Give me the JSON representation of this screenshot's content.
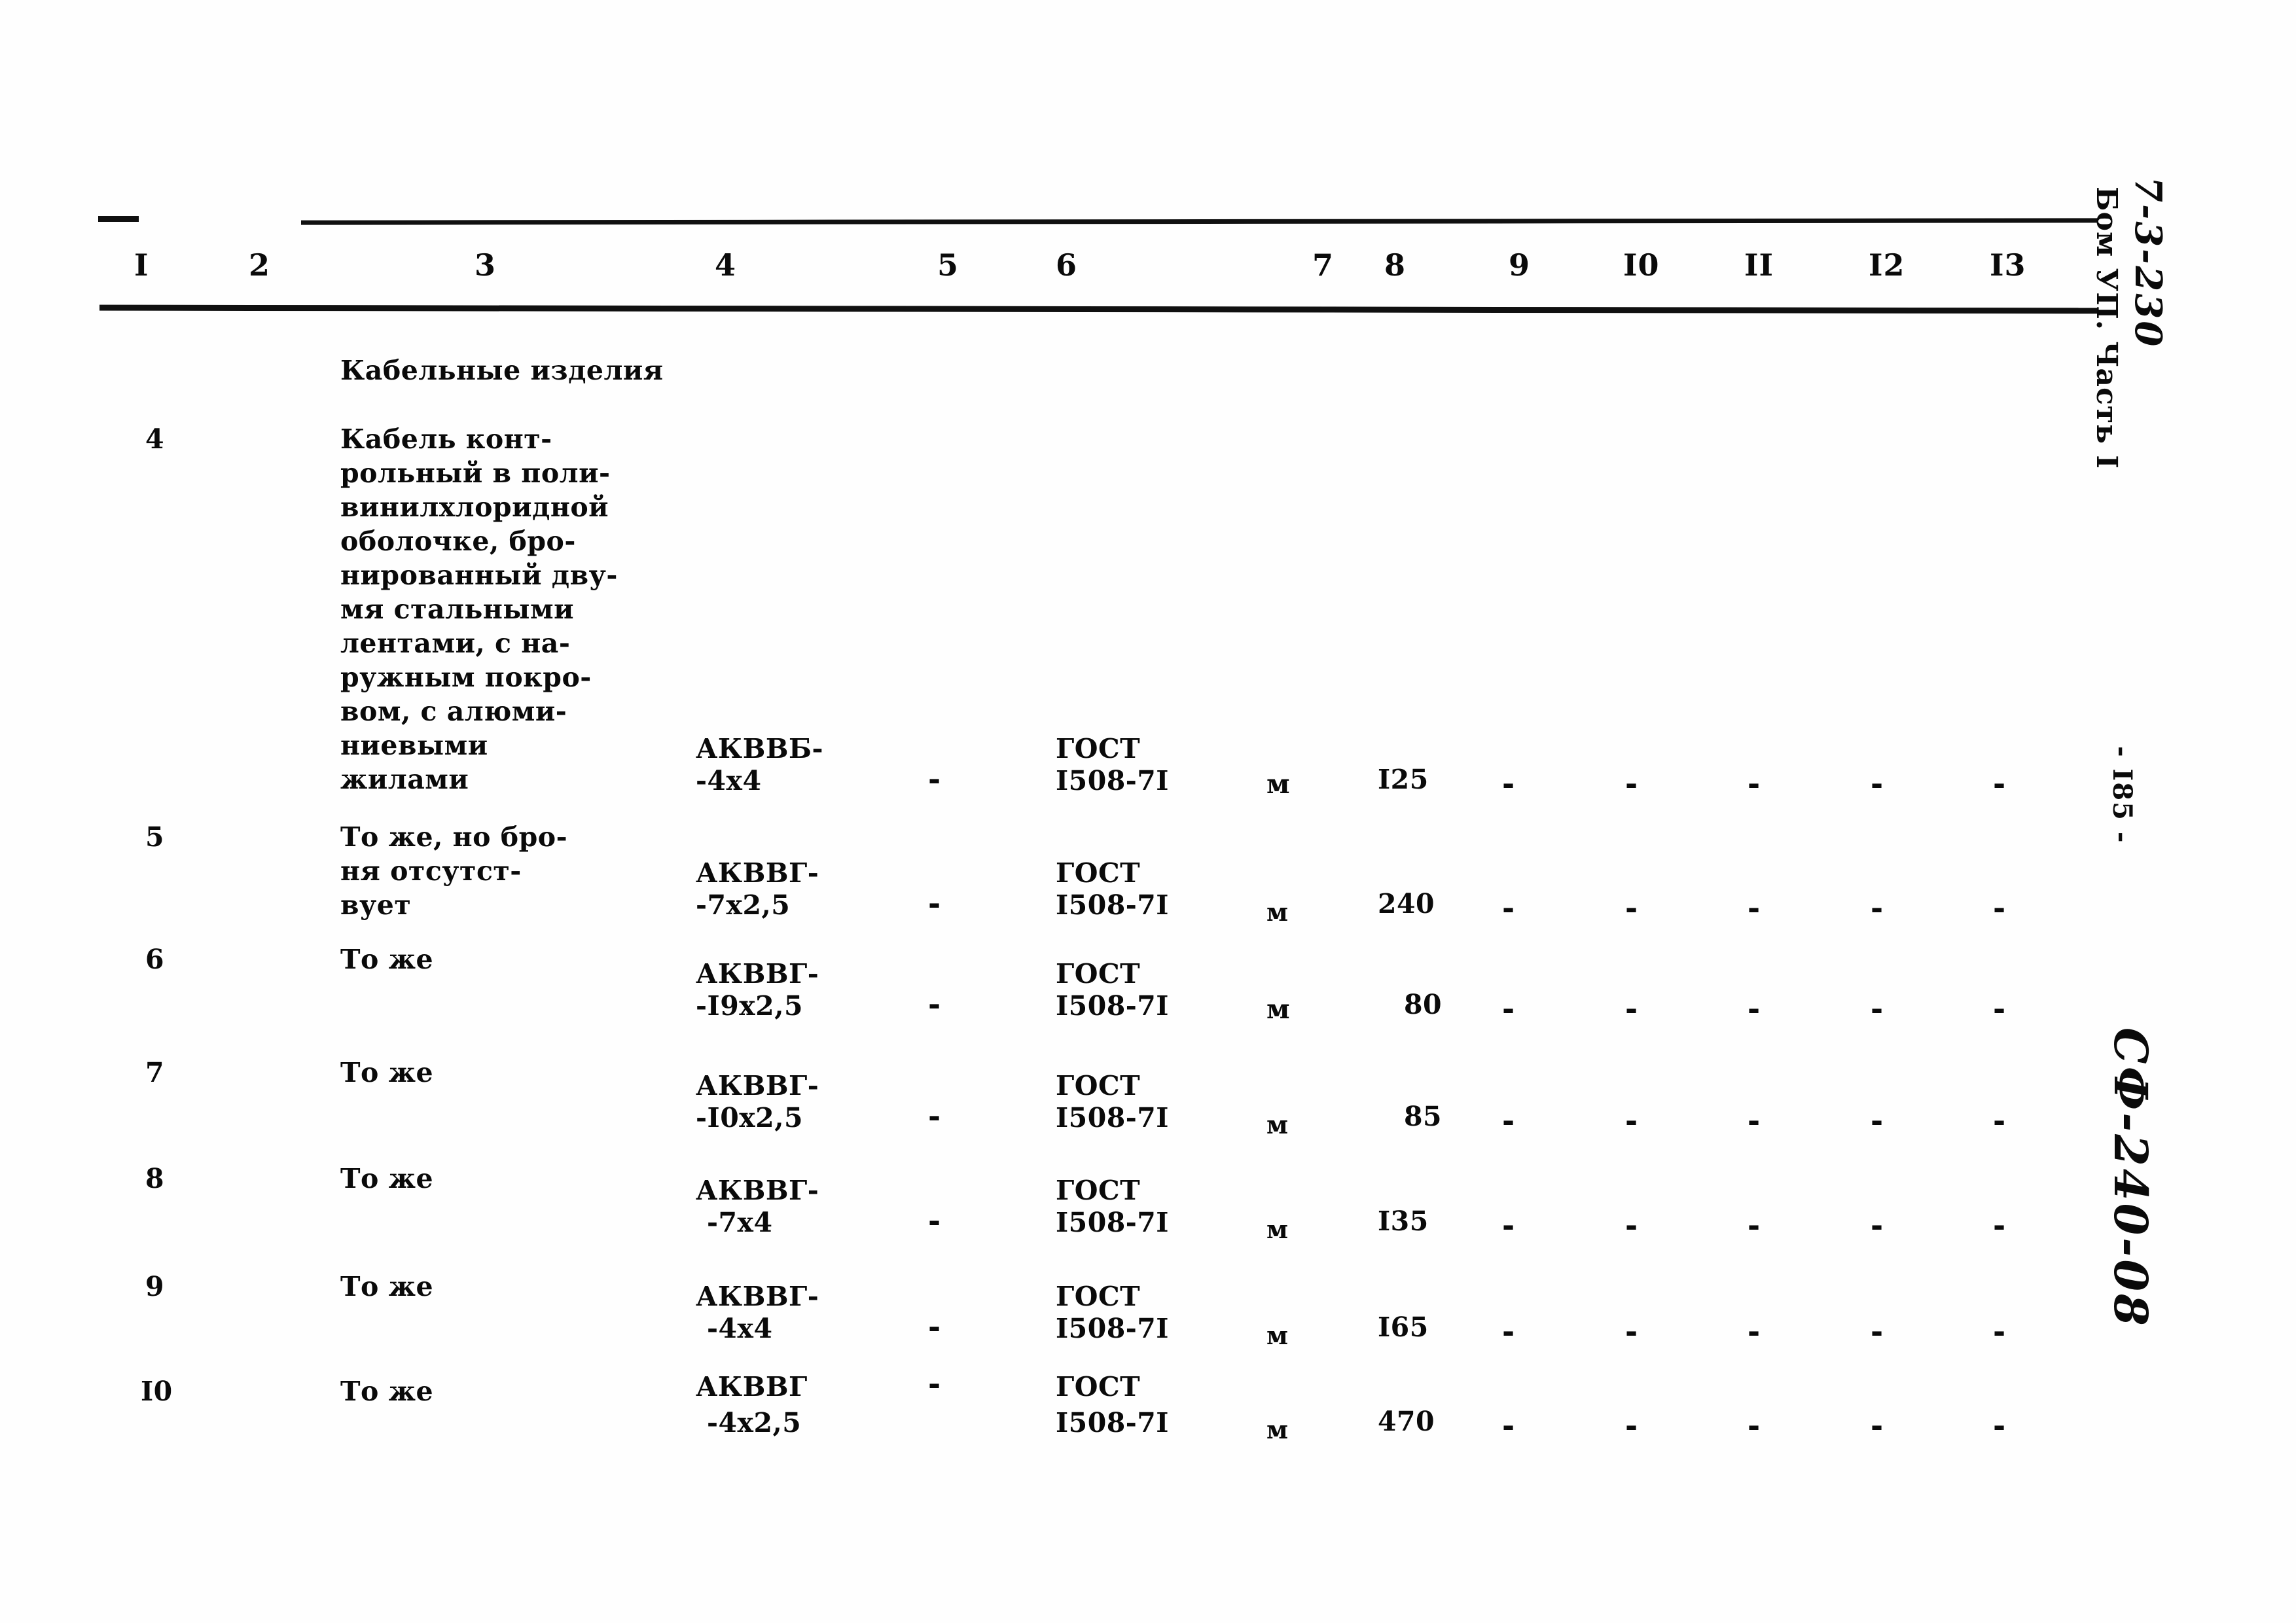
{
  "document": {
    "page_marker": "- I85 -",
    "margin_handwritten_top": "7-3-230",
    "margin_volume_line": "Бом УП. Часть I",
    "margin_handwritten_code": "СФ-240-08"
  },
  "table": {
    "column_headers": [
      "I",
      "2",
      "3",
      "4",
      "5",
      "6",
      "7",
      "8",
      "9",
      "I0",
      "II",
      "I2",
      "I3"
    ],
    "section_title": "Кабельные изделия",
    "rows": [
      {
        "num": "4",
        "name_lines": [
          "Кабель конт-",
          "рольный в поли-",
          "винилхлоридной",
          "оболочке, бро-",
          "нированный дву-",
          "мя стальными",
          "лентами, с на-",
          "ружным покро-",
          "вом, с алюми-",
          "ниевыми",
          "жилами"
        ],
        "type_line1": "АКВВБ-",
        "type_line2": "-4х4",
        "col5": "-",
        "gost_line1": "ГОСТ",
        "gost_line2": "I508-7I",
        "unit": "м",
        "qty": "I25",
        "tail": [
          "-",
          "-",
          "-",
          "-",
          "-"
        ]
      },
      {
        "num": "5",
        "name_lines": [
          "То же, но бро-",
          "ня отсутст-",
          "вует"
        ],
        "type_line1": "АКВВГ-",
        "type_line2": "-7х2,5",
        "col5": "-",
        "gost_line1": "ГОСТ",
        "gost_line2": "I508-7I",
        "unit": "м",
        "qty": "240",
        "tail": [
          "-",
          "-",
          "-",
          "-",
          "-"
        ]
      },
      {
        "num": "6",
        "name_lines": [
          "То же"
        ],
        "type_line1": "АКВВГ-",
        "type_line2": "-I9х2,5",
        "col5": "-",
        "gost_line1": "ГОСТ",
        "gost_line2": "I508-7I",
        "unit": "м",
        "qty": "80",
        "tail": [
          "-",
          "-",
          "-",
          "-",
          "-"
        ]
      },
      {
        "num": "7",
        "name_lines": [
          "То же"
        ],
        "type_line1": "АКВВГ-",
        "type_line2": "-I0х2,5",
        "col5": "-",
        "gost_line1": "ГОСТ",
        "gost_line2": "I508-7I",
        "unit": "м",
        "qty": "85",
        "tail": [
          "-",
          "-",
          "-",
          "-",
          "-"
        ]
      },
      {
        "num": "8",
        "name_lines": [
          "То же"
        ],
        "type_line1": "АКВВГ-",
        "type_line2": "-7х4",
        "col5": "-",
        "gost_line1": "ГОСТ",
        "gost_line2": "I508-7I",
        "unit": "м",
        "qty": "I35",
        "tail": [
          "-",
          "-",
          "-",
          "-",
          "-"
        ]
      },
      {
        "num": "9",
        "name_lines": [
          "То же"
        ],
        "type_line1": "АКВВГ-",
        "type_line2": "-4х4",
        "col5": "-",
        "gost_line1": "ГОСТ",
        "gost_line2": "I508-7I",
        "unit": "м",
        "qty": "I65",
        "tail": [
          "-",
          "-",
          "-",
          "-",
          "-"
        ]
      },
      {
        "num": "I0",
        "name_lines": [
          "То же"
        ],
        "type_line1": "АКВВГ",
        "type_line2": "-4х2,5",
        "col5": "-",
        "gost_line1": "ГОСТ",
        "gost_line2": "I508-7I",
        "unit": "м",
        "qty": "470",
        "tail": [
          "-",
          "-",
          "-",
          "-",
          "-"
        ]
      }
    ]
  }
}
